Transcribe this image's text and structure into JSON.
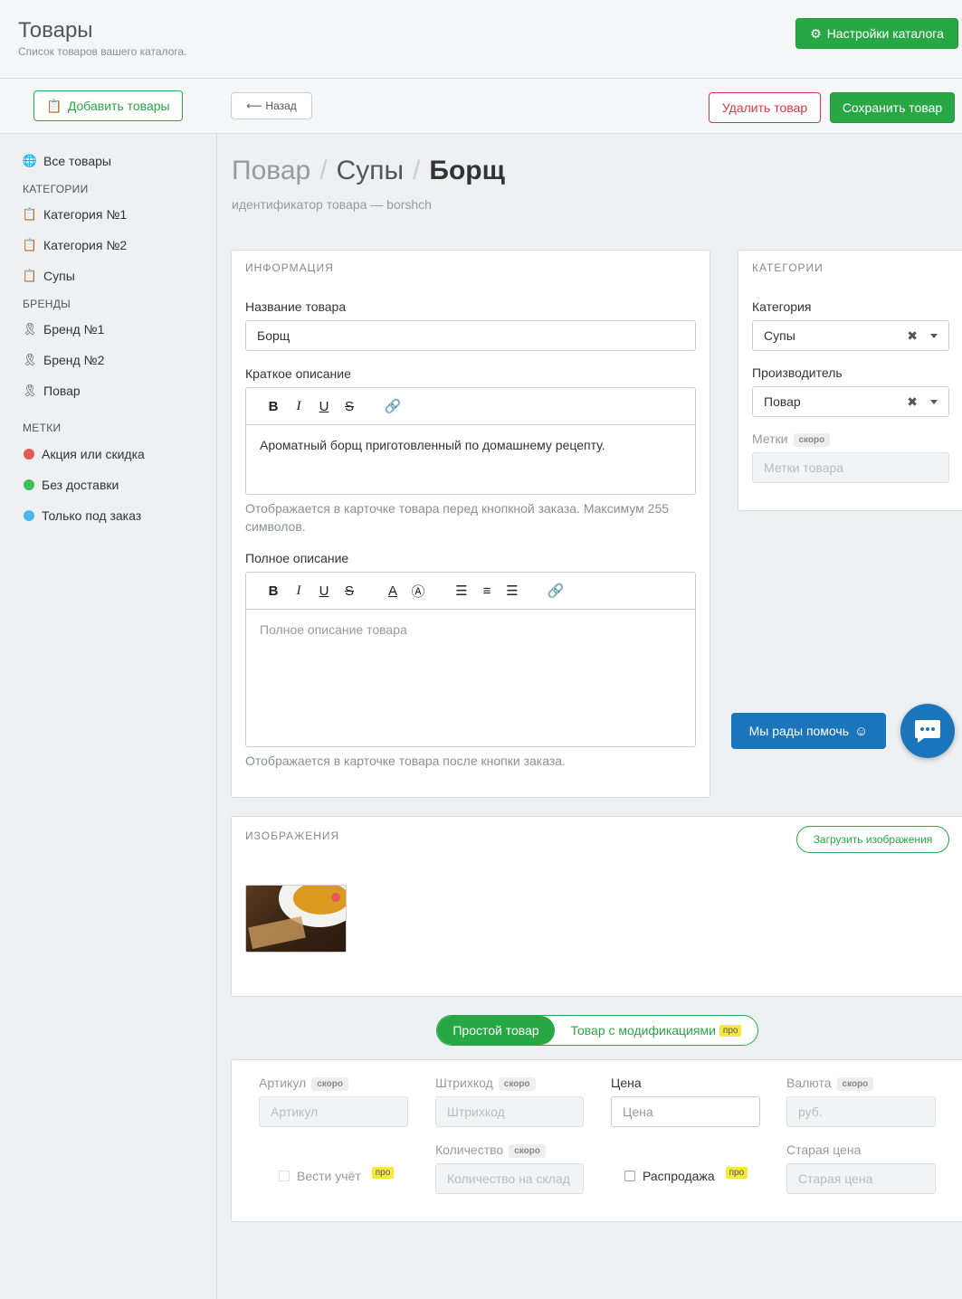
{
  "header": {
    "title": "Товары",
    "subtitle": "Список товаров вашего каталога.",
    "catalog_settings": "Настройки каталога"
  },
  "sidebar": {
    "add_button": "Добавить товары",
    "all_products": "Все товары",
    "categories_head": "КАТЕГОРИИ",
    "categories": [
      "Категория №1",
      "Категория №2",
      "Супы"
    ],
    "brands_head": "БРЕНДЫ",
    "brands": [
      "Бренд №1",
      "Бренд №2",
      "Повар"
    ],
    "tags_head": "МЕТКИ",
    "tags": [
      {
        "label": "Акция или скидка",
        "color": "#e05a5a"
      },
      {
        "label": "Без доставки",
        "color": "#3cc15a"
      },
      {
        "label": "Только под заказ",
        "color": "#4bb8e8"
      }
    ]
  },
  "toolbar": {
    "back": "Назад",
    "delete": "Удалить товар",
    "save": "Сохранить товар"
  },
  "breadcrumb": {
    "a": "Повар",
    "b": "Супы",
    "current": "Борщ"
  },
  "slug": "идентификатор товара — borshch",
  "info": {
    "title": "ИНФОРМАЦИЯ",
    "name_label": "Название товара",
    "name_value": "Борщ",
    "short_label": "Краткое описание",
    "short_value": "Ароматный борщ приготовленный по домашнему рецепту.",
    "short_help": "Отображается в карточке товара перед кнопкной заказа. Максимум 255 символов.",
    "full_label": "Полное описание",
    "full_placeholder": "Полное описание товара",
    "full_help": "Отображается в карточке товара после кнопки заказа."
  },
  "categories_panel": {
    "title": "КАТЕГОРИИ",
    "category_label": "Категория",
    "category_value": "Супы",
    "maker_label": "Производитель",
    "maker_value": "Повар",
    "tags_label": "Метки",
    "tags_badge": "скоро",
    "tags_placeholder": "Метки товара"
  },
  "help": {
    "label": "Мы рады помочь"
  },
  "images": {
    "title": "ИЗОБРАЖЕНИЯ",
    "upload": "Загрузить изображения"
  },
  "mode": {
    "simple": "Простой товар",
    "mods": "Товар с модификациями",
    "pro": "про"
  },
  "fields": {
    "sku_label": "Артикул",
    "sku_badge": "скоро",
    "sku_ph": "Артикул",
    "barcode_label": "Штрихкод",
    "barcode_badge": "скоро",
    "barcode_ph": "Штрихкод",
    "price_label": "Цена",
    "price_ph": "Цена",
    "currency_label": "Валюта",
    "currency_badge": "скоро",
    "currency_ph": "руб.",
    "track_label": "Вести учёт",
    "track_pro": "про",
    "qty_label": "Количество",
    "qty_badge": "скоро",
    "qty_ph": "Количество на склад",
    "sale_label": "Распродажа",
    "sale_pro": "про",
    "old_label": "Старая цена",
    "old_ph": "Старая цена"
  }
}
